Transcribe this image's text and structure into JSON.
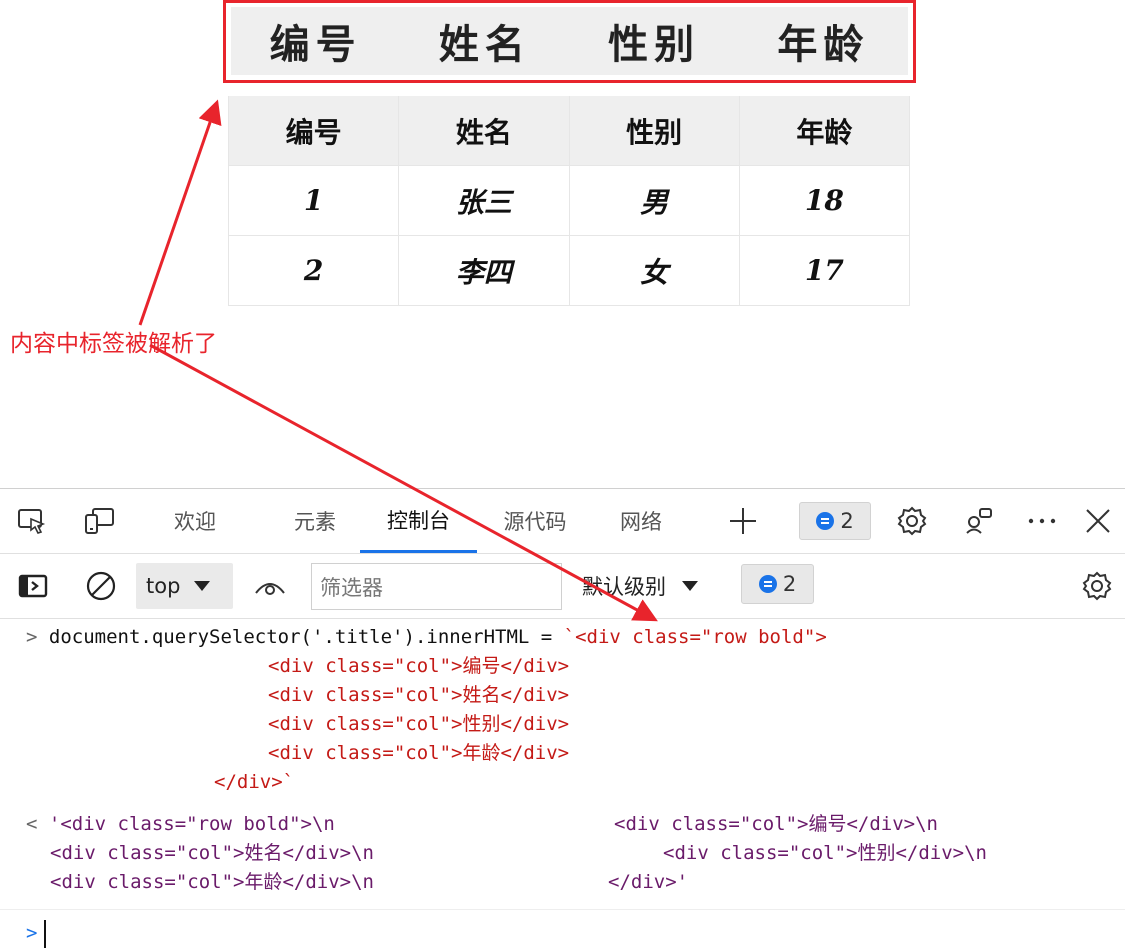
{
  "title_row": [
    "编号",
    "姓名",
    "性别",
    "年龄"
  ],
  "table": {
    "headers": [
      "编号",
      "姓名",
      "性别",
      "年龄"
    ],
    "rows": [
      [
        "1",
        "张三",
        "男",
        "18"
      ],
      [
        "2",
        "李四",
        "女",
        "17"
      ]
    ]
  },
  "annotation": "内容中标签被解析了",
  "colors": {
    "annotation_red": "#e8242c",
    "accent_blue": "#1a73e8",
    "code_red": "#c41a16"
  },
  "devtools": {
    "tabs": [
      "欢迎",
      "元素",
      "控制台",
      "源代码",
      "网络"
    ],
    "active_tab": "控制台",
    "issues_count": "2",
    "context_select": "top",
    "filter_placeholder": "筛选器",
    "level_label": "默认级别",
    "level_count": "2",
    "icons": [
      "inspect-icon",
      "device-emulation-icon",
      "add-tab-icon",
      "settings-icon",
      "customize-icon",
      "more-icon",
      "close-icon",
      "sidebar-toggle-icon",
      "clear-console-icon",
      "live-expression-eye-icon",
      "console-settings-icon"
    ]
  },
  "console": {
    "input_lines": [
      "document.querySelector('.title').innerHTML = ",
      "`<div class=\"row bold\">",
      "<div class=\"col\">编号</div>",
      "<div class=\"col\">姓名</div>",
      "<div class=\"col\">性别</div>",
      "<div class=\"col\">年龄</div>",
      "</div>`"
    ],
    "output_lines": [
      "'<div class=\"row bold\">\\n",
      "<div class=\"col\">编号</div>\\n",
      "<div class=\"col\">姓名</div>\\n",
      "<div class=\"col\">性别</div>\\n",
      "<div class=\"col\">年龄</div>\\n",
      "</div>'"
    ]
  }
}
